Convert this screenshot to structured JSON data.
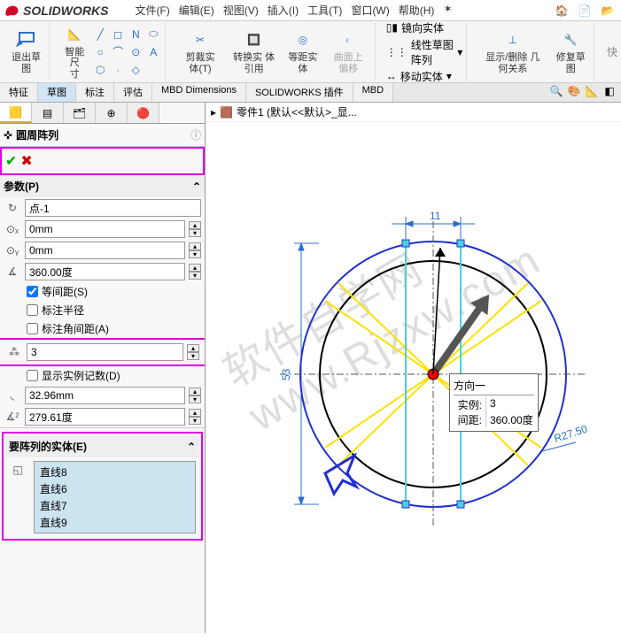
{
  "app": {
    "name": "SOLIDWORKS"
  },
  "menu": {
    "file": "文件(F)",
    "edit": "编辑(E)",
    "view": "视图(V)",
    "insert": "插入(I)",
    "tools": "工具(T)",
    "window": "窗口(W)",
    "help": "帮助(H)"
  },
  "toolbar": {
    "exit_sketch": "退出草\n图",
    "smart_dim": "智能尺\n寸",
    "trim": "剪裁实\n体(T)",
    "convert": "转换实\n体引用",
    "offset": "等距实\n体",
    "surface": "曲面上\n偏移",
    "mirror": "镜向实体",
    "linear_pattern": "线性草图阵列",
    "move": "移动实体",
    "display_hide": "显示/删除\n几何关系",
    "repair": "修复草\n图"
  },
  "tabs": {
    "feature": "特征",
    "sketch": "草图",
    "annotate": "标注",
    "evaluate": "评估",
    "mbd": "MBD Dimensions",
    "plugin": "SOLIDWORKS 插件",
    "mbd2": "MBD"
  },
  "breadcrumb": {
    "part": "零件1 (默认<<默认>_显..."
  },
  "feature": {
    "title": "圆周阵列"
  },
  "params": {
    "title": "参数(P)",
    "point": "点-1",
    "x": "0mm",
    "y": "0mm",
    "angle": "360.00度",
    "equal_spacing": "等间距(S)",
    "dimension_radius": "标注半径",
    "dimension_angular": "标注角间距(A)",
    "instances": "3",
    "show_count": "显示实例记数(D)",
    "r1": "32.96mm",
    "r2": "279.61度"
  },
  "entities": {
    "title": "要阵列的实体(E)",
    "items": [
      "直线8",
      "直线6",
      "直线7",
      "直线9"
    ]
  },
  "canvas": {
    "dim_top": "11",
    "dim_left": "53",
    "dim_radius": "R27.50"
  },
  "tooltip": {
    "dir": "方向一",
    "instances_label": "实例:",
    "instances_val": "3",
    "spacing_label": "间距:",
    "spacing_val": "360.00度"
  },
  "watermark": "软件自学网\nwww.Rjzxw.com"
}
